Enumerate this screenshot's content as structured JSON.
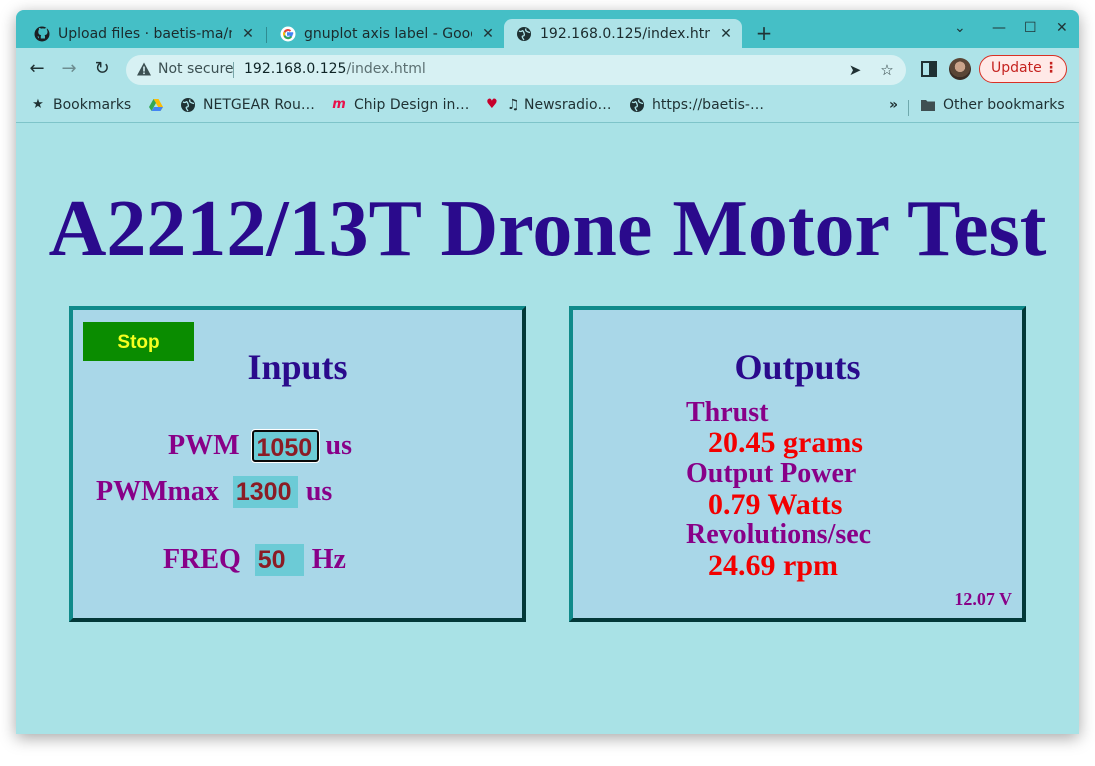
{
  "tabs": [
    {
      "title": "Upload files · baetis-ma/m",
      "icon": "github-icon"
    },
    {
      "title": "gnuplot axis label - Googl",
      "icon": "google-icon"
    },
    {
      "title": "192.168.0.125/index.html",
      "icon": "globe-icon",
      "active": true
    }
  ],
  "toolbar": {
    "security_label": "Not secure",
    "url_host": "192.168.0.125",
    "url_path": "/index.html",
    "update_label": "Update"
  },
  "bookmarks": {
    "items": [
      {
        "label": "Bookmarks",
        "icon": "star-icon"
      },
      {
        "label": "",
        "icon": "google-drive-icon"
      },
      {
        "label": "NETGEAR Rou…",
        "icon": "globe-icon"
      },
      {
        "label": "Chip Design in…",
        "icon": "m-logo-icon"
      },
      {
        "label": "♫ Newsradio…",
        "icon": "iheart-icon"
      },
      {
        "label": "https://baetis-…",
        "icon": "globe-icon"
      }
    ],
    "other_label": "Other bookmarks"
  },
  "page": {
    "title": "A2212/13T Drone Motor Test",
    "inputs": {
      "heading": "Inputs",
      "stop_label": "Stop",
      "pwm_label": "PWM",
      "pwm_value": "1050",
      "pwm_unit": "us",
      "pwmmax_label": "PWMmax",
      "pwmmax_value": "1300",
      "pwmmax_unit": "us",
      "freq_label": "FREQ",
      "freq_value": "50",
      "freq_unit": "Hz"
    },
    "outputs": {
      "heading": "Outputs",
      "thrust_label": "Thrust",
      "thrust_value": "20.45 grams",
      "power_label": "Output Power",
      "power_value": "0.79 Watts",
      "rev_label": "Revolutions/sec",
      "rev_value": "24.69 rpm",
      "voltage": "12.07 V"
    }
  },
  "colors": {
    "title": "#2a0a8c",
    "label": "#880088",
    "value": "#f20000",
    "stop_bg": "#0a8c00",
    "stop_text": "#f5ff20",
    "page_bg": "#a9e2e6"
  }
}
